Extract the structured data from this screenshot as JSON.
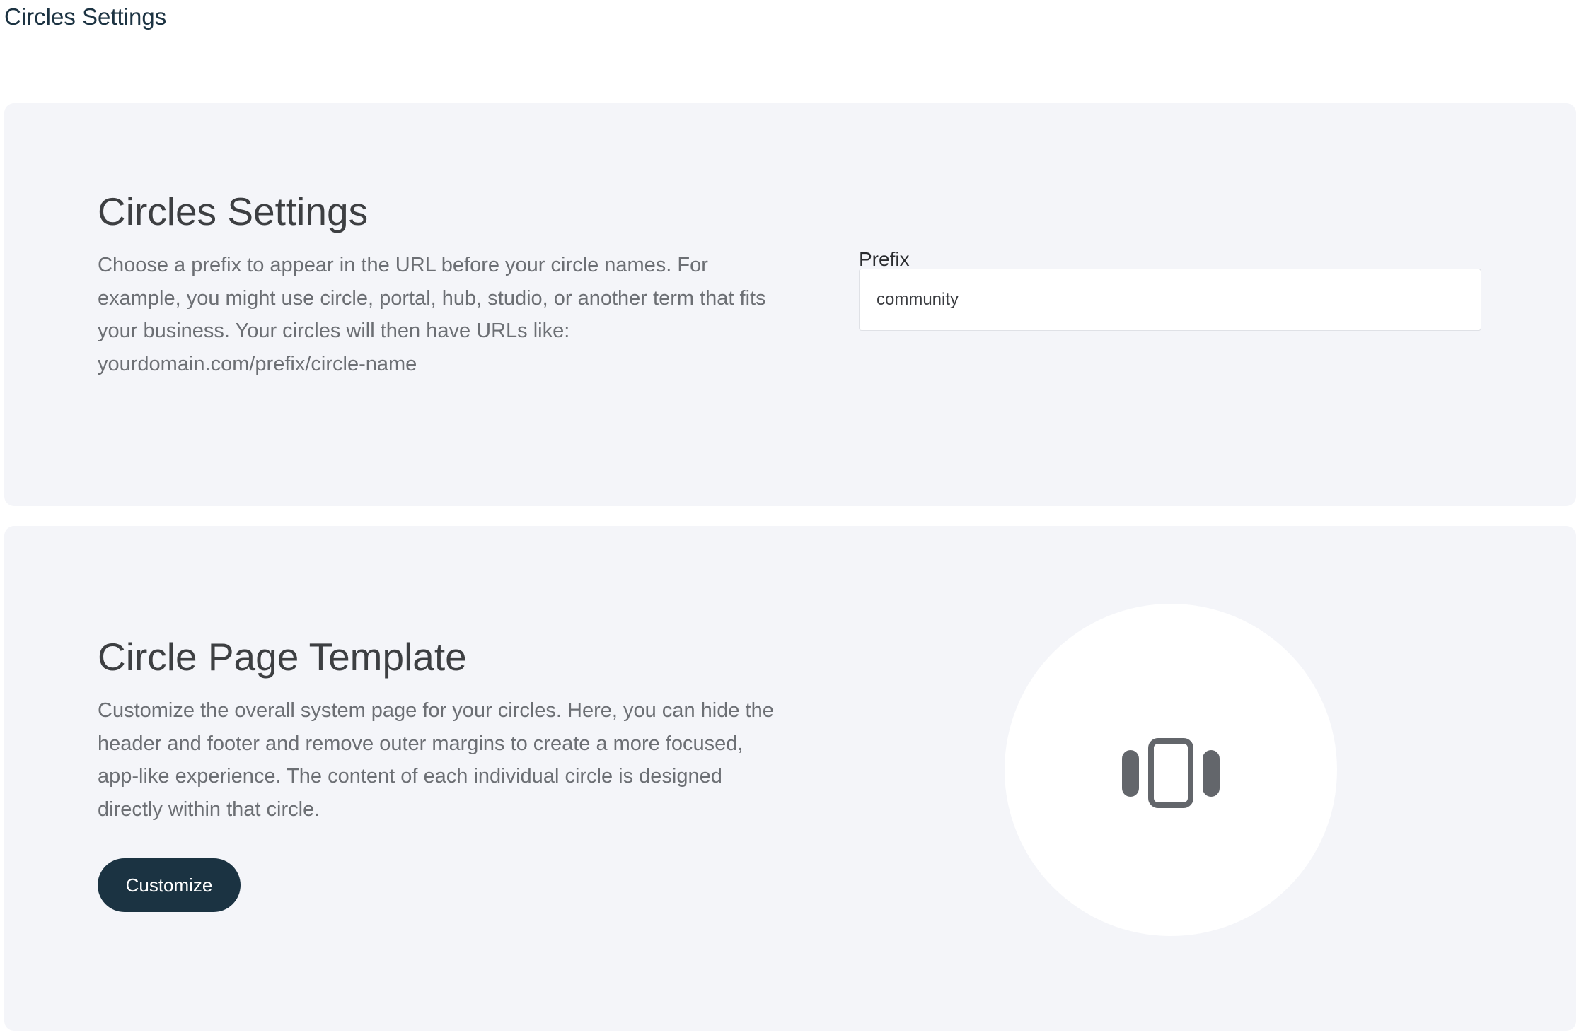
{
  "header": {
    "title": "Circles Settings"
  },
  "settings_panel": {
    "title": "Circles Settings",
    "description": "Choose a prefix to appear in the URL before your circle names. For example, you might use circle, portal, hub, studio, or another term that fits your business. Your circles will then have URLs like: yourdomain.com/prefix/circle-name",
    "prefix_label": "Prefix",
    "prefix_value": "community"
  },
  "template_panel": {
    "title": "Circle Page Template",
    "description": "Customize the overall system page for your circles. Here, you can hide the header and footer and remove outer margins to create a more focused, app-like experience. The content of each individual circle is designed directly within that circle.",
    "button_label": "Customize",
    "icon": "carousel-icon"
  },
  "colors": {
    "accent": "#1b3342",
    "panel_bg": "#f4f5f9",
    "icon": "#63666b"
  }
}
